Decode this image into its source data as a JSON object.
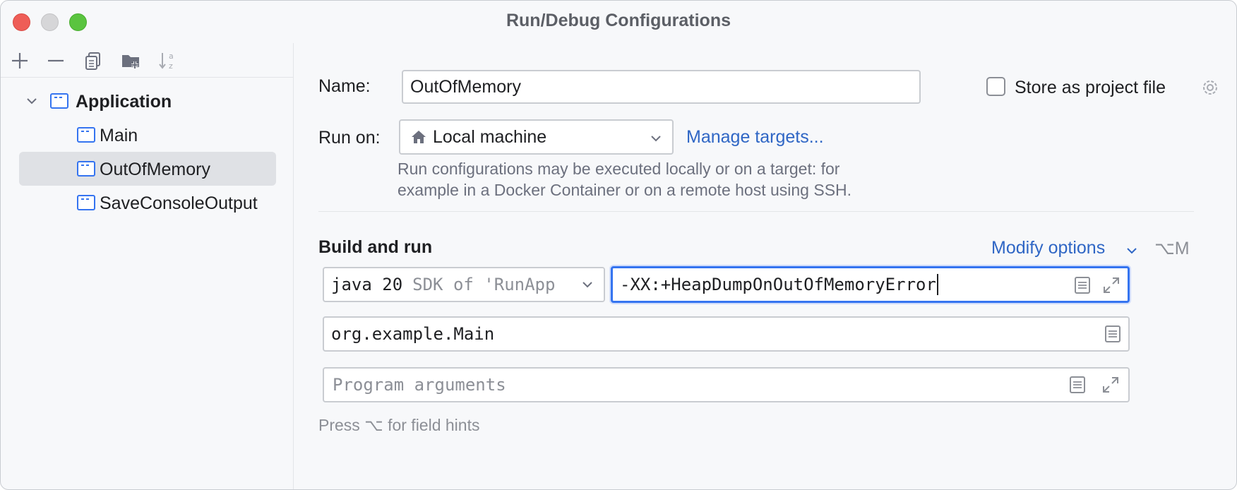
{
  "window": {
    "title": "Run/Debug Configurations"
  },
  "toolbar": {
    "add_icon": "plus-icon",
    "remove_icon": "minus-icon",
    "copy_icon": "copy-icon",
    "folder_icon": "new-folder-icon",
    "sort_icon": "sort-az-icon"
  },
  "tree": {
    "group_label": "Application",
    "items": [
      {
        "label": "Main",
        "selected": false
      },
      {
        "label": "OutOfMemory",
        "selected": true
      },
      {
        "label": "SaveConsoleOutput",
        "selected": false
      }
    ]
  },
  "form": {
    "name_label": "Name:",
    "name_value": "OutOfMemory",
    "store_label": "Store as project file",
    "store_checked": false,
    "run_on_label": "Run on:",
    "run_on_value": "Local machine",
    "manage_targets": "Manage targets...",
    "run_on_hint_line1": "Run configurations may be executed locally or on a target: for",
    "run_on_hint_line2": "example in a Docker Container or on a remote host using SSH.",
    "build_run_title": "Build and run",
    "modify_options": "Modify options",
    "modify_shortcut": "⌥M",
    "jdk_value": "java 20",
    "jdk_suffix": "SDK of 'RunApp",
    "vm_options_value": "-XX:+HeapDumpOnOutOfMemoryError",
    "main_class_value": "org.example.Main",
    "program_args_placeholder": "Program arguments",
    "field_hints": "Press ⌥ for field hints"
  },
  "colors": {
    "accent": "#3574f0",
    "link": "#2f66c5",
    "selection": "#dfe1e5",
    "close": "#ee5d57",
    "minimize": "#d6d6d8",
    "maximize": "#5ac43f"
  }
}
